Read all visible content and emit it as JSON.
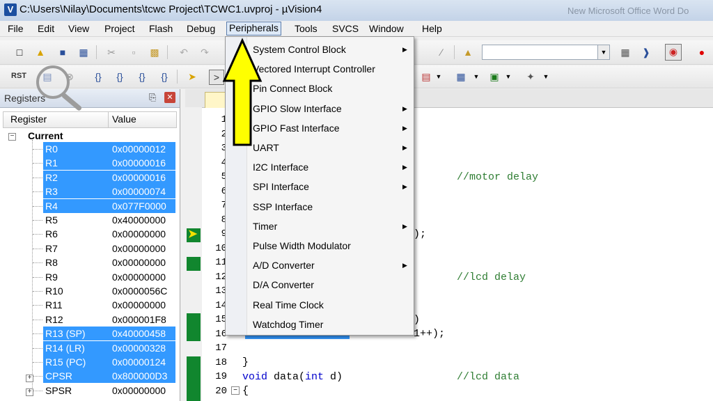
{
  "window": {
    "title": "C:\\Users\\Nilay\\Documents\\tcwc Project\\TCWC1.uvproj - µVision4",
    "bg_window_title": "New Microsoft Office Word Do"
  },
  "menubar": {
    "items": [
      "File",
      "Edit",
      "View",
      "Project",
      "Flash",
      "Debug",
      "Peripherals",
      "Tools",
      "SVCS",
      "Window",
      "Help"
    ],
    "active": "Peripherals"
  },
  "toolbar2": {
    "reset_label": "RST"
  },
  "registers": {
    "title": "Registers",
    "col_register": "Register",
    "col_value": "Value",
    "group": "Current",
    "rows": [
      {
        "name": "R0",
        "value": "0x00000012",
        "selected": true
      },
      {
        "name": "R1",
        "value": "0x00000016",
        "selected": true
      },
      {
        "name": "R2",
        "value": "0x00000016",
        "selected": true
      },
      {
        "name": "R3",
        "value": "0x00000074",
        "selected": true
      },
      {
        "name": "R4",
        "value": "0x077F0000",
        "selected": true
      },
      {
        "name": "R5",
        "value": "0x40000000",
        "selected": false
      },
      {
        "name": "R6",
        "value": "0x00000000",
        "selected": false
      },
      {
        "name": "R7",
        "value": "0x00000000",
        "selected": false
      },
      {
        "name": "R8",
        "value": "0x00000000",
        "selected": false
      },
      {
        "name": "R9",
        "value": "0x00000000",
        "selected": false
      },
      {
        "name": "R10",
        "value": "0x0000056C",
        "selected": false
      },
      {
        "name": "R11",
        "value": "0x00000000",
        "selected": false
      },
      {
        "name": "R12",
        "value": "0x000001F8",
        "selected": false
      },
      {
        "name": "R13 (SP)",
        "value": "0x40000458",
        "selected": true
      },
      {
        "name": "R14 (LR)",
        "value": "0x00000328",
        "selected": true
      },
      {
        "name": "R15 (PC)",
        "value": "0x00000124",
        "selected": true
      },
      {
        "name": "CPSR",
        "value": "0x800000D3",
        "selected": true
      },
      {
        "name": "SPSR",
        "value": "0x00000000",
        "selected": false
      }
    ]
  },
  "editor": {
    "line_numbers": [
      "1",
      "2",
      "3",
      "4",
      "5",
      "6",
      "7",
      "8",
      "9",
      "10",
      "11",
      "12",
      "13",
      "14",
      "15",
      "16",
      "17",
      "18",
      "19",
      "20"
    ],
    "code": {
      "line5_comment": "//motor delay",
      "line9_tail": ");",
      "line12_comment": "//lcd delay",
      "line15_tail": ")",
      "line16_tail": "1++);",
      "line18": "}",
      "line19_kw1": "void",
      "line19_mid": " data(",
      "line19_kw2": "int",
      "line19_tail": " d)",
      "line19_comment": "//lcd data",
      "line20": "{"
    }
  },
  "peripherals_menu": {
    "items": [
      {
        "label": "System Control Block",
        "submenu": true
      },
      {
        "label": "Vectored Interrupt Controller",
        "submenu": false
      },
      {
        "label": "Pin Connect Block",
        "submenu": false
      },
      {
        "label": "GPIO Slow Interface",
        "submenu": true
      },
      {
        "label": "GPIO Fast Interface",
        "submenu": true
      },
      {
        "label": "UART",
        "submenu": true
      },
      {
        "label": "I2C Interface",
        "submenu": true
      },
      {
        "label": "SPI Interface",
        "submenu": true
      },
      {
        "label": "SSP Interface",
        "submenu": false
      },
      {
        "label": "Timer",
        "submenu": true
      },
      {
        "label": "Pulse Width Modulator",
        "submenu": false
      },
      {
        "label": "A/D Converter",
        "submenu": true
      },
      {
        "label": "D/A Converter",
        "submenu": false
      },
      {
        "label": "Real Time Clock",
        "submenu": false
      },
      {
        "label": "Watchdog Timer",
        "submenu": false
      }
    ]
  },
  "colors": {
    "selection": "#3399ff",
    "breakpoint_bar": "#11862e",
    "annotation_arrow": "#ffff00",
    "comment": "#2e7d32",
    "keyword": "#0000cc"
  }
}
